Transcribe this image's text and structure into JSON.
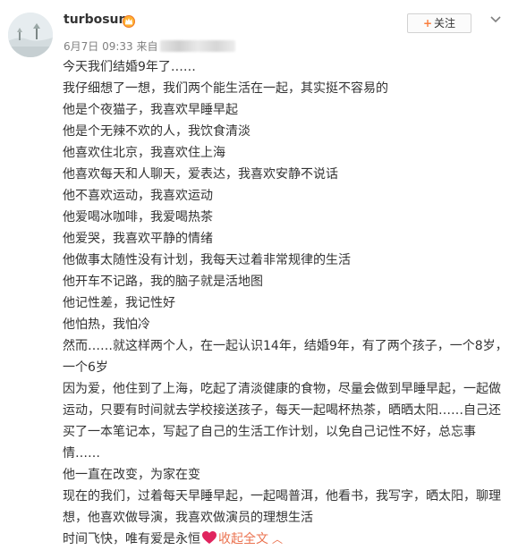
{
  "user": {
    "name": "turbosun"
  },
  "meta": {
    "date": "6月7日 09:33",
    "from_label": "来自"
  },
  "follow_button": {
    "plus": "+",
    "label": "关注"
  },
  "post": {
    "lines": [
      "今天我们结婚9年了……",
      "我仔细想了一想，我们两个能生活在一起，其实挺不容易的",
      "他是个夜猫子，我喜欢早睡早起",
      "他是个无辣不欢的人，我饮食清淡",
      "他喜欢住北京，我喜欢住上海",
      "他喜欢每天和人聊天，爱表达，我喜欢安静不说话",
      "他不喜欢运动，我喜欢运动",
      "他爱喝冰咖啡，我爱喝热茶",
      "他爱哭，我喜欢平静的情绪",
      "他做事太随性没有计划，我每天过着非常规律的生活",
      "他开车不记路，我的脑子就是活地图",
      "他记性差，我记性好",
      "他怕热，我怕冷",
      "然而……就这样两个人，在一起认识14年，结婚9年，有了两个孩子，一个8岁，一个6岁",
      "因为爱，他住到了上海，吃起了清淡健康的食物，尽量会做到早睡早起，一起做运动，只要有时间就去学校接送孩子，每天一起喝杯热茶，晒晒太阳……自己还买了一本笔记本，写起了自己的生活工作计划，以免自己记性不好，总忘事情……",
      "他一直在改变，为家在变",
      "现在的我们，过着每天早睡早起，一起喝普洱，他看书，我写字，晒太阳，聊理想，他喜欢做导演，我喜欢做演员的理想生活"
    ],
    "last_line_text": "时间飞快，唯有爱是永恒",
    "collapse_label": "收起全文",
    "collapse_arrow": "︿"
  },
  "colors": {
    "link": "#eb7350",
    "follow_plus": "#fa7d3c",
    "heart": "#e0245e"
  },
  "icons": [
    "crown-icon",
    "chevron-down-icon",
    "heart-icon"
  ]
}
